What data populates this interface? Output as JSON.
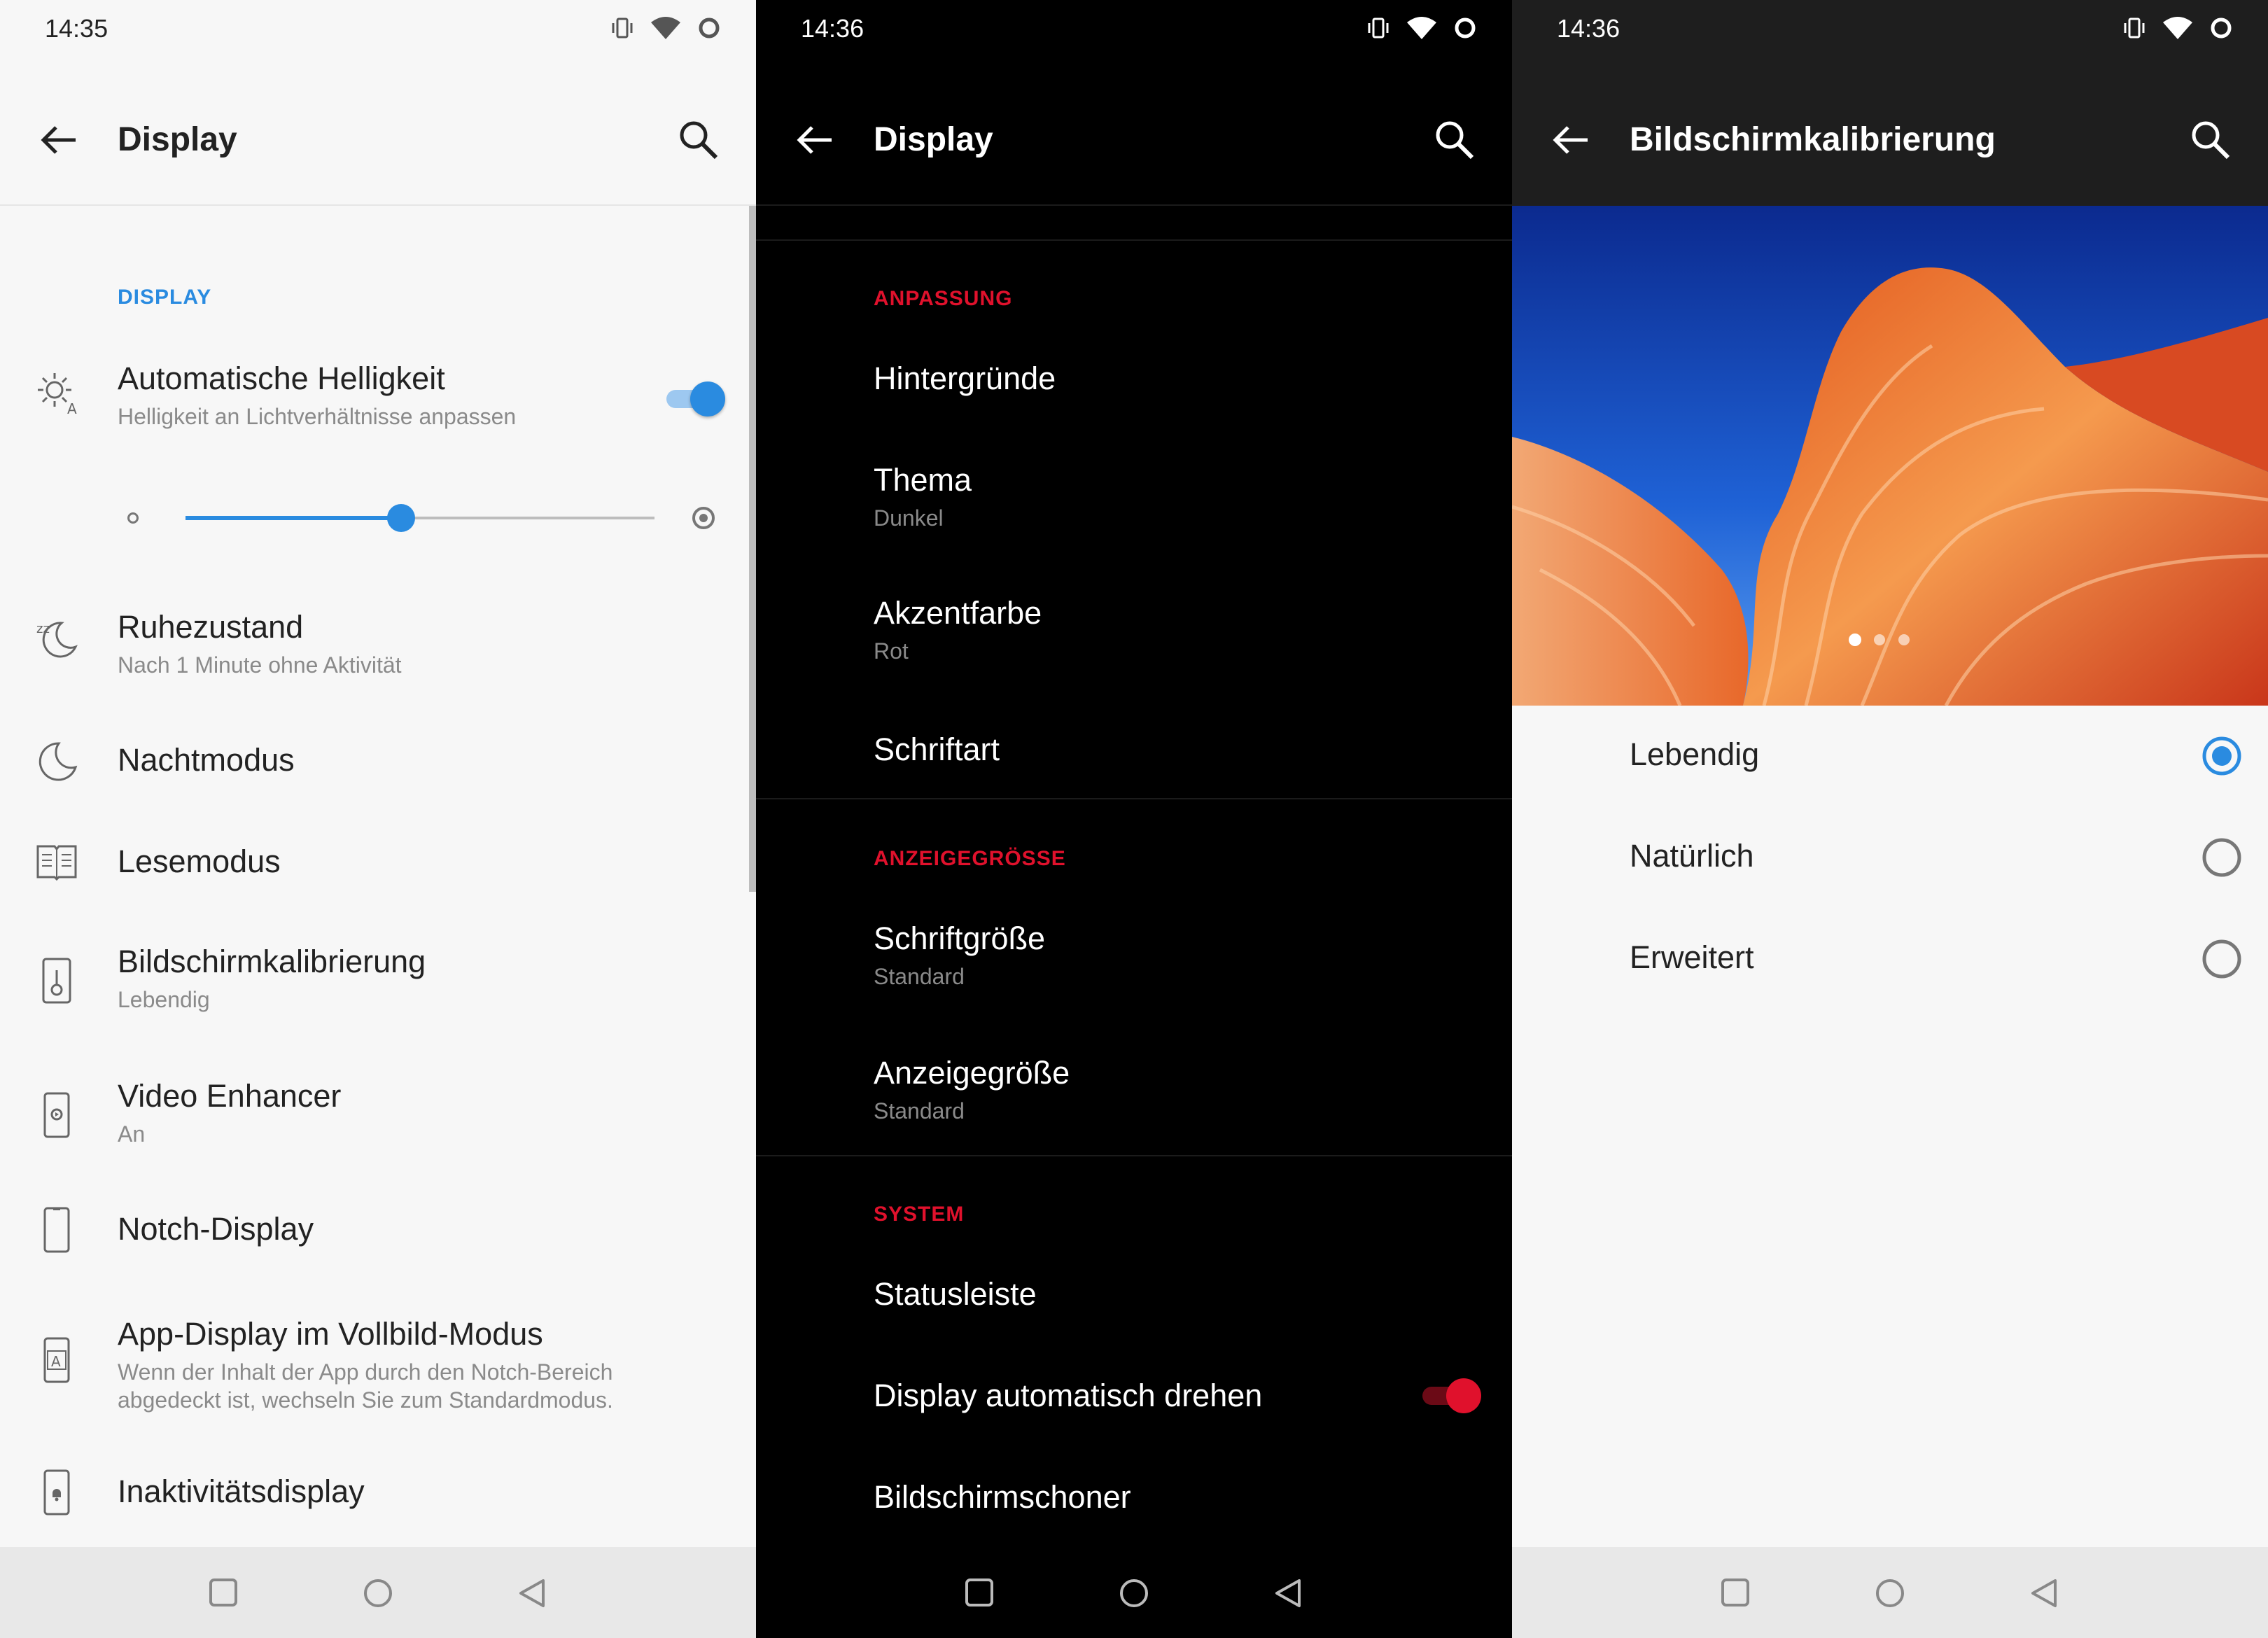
{
  "colors": {
    "blue": "#2a8be0",
    "red": "#e0112c"
  },
  "panel1": {
    "time": "14:35",
    "title": "Display",
    "section": "DISPLAY",
    "auto_brightness": {
      "title": "Automatische Helligkeit",
      "sub": "Helligkeit an Lichtverhältnisse anpassen",
      "enabled": true
    },
    "brightness_level": 0.46,
    "items": [
      {
        "title": "Ruhezustand",
        "sub": "Nach 1 Minute ohne Aktivität",
        "icon": "sleep-icon"
      },
      {
        "title": "Nachtmodus",
        "icon": "moon-icon"
      },
      {
        "title": "Lesemodus",
        "icon": "book-icon"
      },
      {
        "title": "Bildschirmkalibrierung",
        "sub": "Lebendig",
        "icon": "thermometer-icon"
      },
      {
        "title": "Video Enhancer",
        "sub": "An",
        "icon": "video-enhancer-icon"
      },
      {
        "title": "Notch-Display",
        "icon": "phone-outline-icon"
      },
      {
        "title": "App-Display im Vollbild-Modus",
        "sub1": "Wenn der Inhalt der App durch den Notch-Bereich",
        "sub2": "abgedeckt ist, wechseln Sie zum Standardmodus.",
        "icon": "app-fullscreen-icon"
      },
      {
        "title": "Inaktivitätsdisplay",
        "icon": "ambient-display-icon"
      }
    ]
  },
  "panel2": {
    "time": "14:36",
    "title": "Display",
    "sections": [
      {
        "label": "ANPASSUNG"
      },
      {
        "label": "ANZEIGEGRÖSSE"
      },
      {
        "label": "SYSTEM"
      }
    ],
    "items": [
      {
        "title": "Hintergründe"
      },
      {
        "title": "Thema",
        "sub": "Dunkel"
      },
      {
        "title": "Akzentfarbe",
        "sub": "Rot"
      },
      {
        "title": "Schriftart"
      },
      {
        "title": "Schriftgröße",
        "sub": "Standard"
      },
      {
        "title": "Anzeigegröße",
        "sub": "Standard"
      },
      {
        "title": "Statusleiste"
      },
      {
        "title": "Display automatisch drehen",
        "enabled": true
      },
      {
        "title": "Bildschirmschoner"
      }
    ]
  },
  "panel3": {
    "time": "14:36",
    "title": "Bildschirmkalibrierung",
    "options": [
      {
        "label": "Lebendig",
        "selected": true
      },
      {
        "label": "Natürlich",
        "selected": false
      },
      {
        "label": "Erweitert",
        "selected": false
      }
    ],
    "carousel_active_index": 0
  }
}
